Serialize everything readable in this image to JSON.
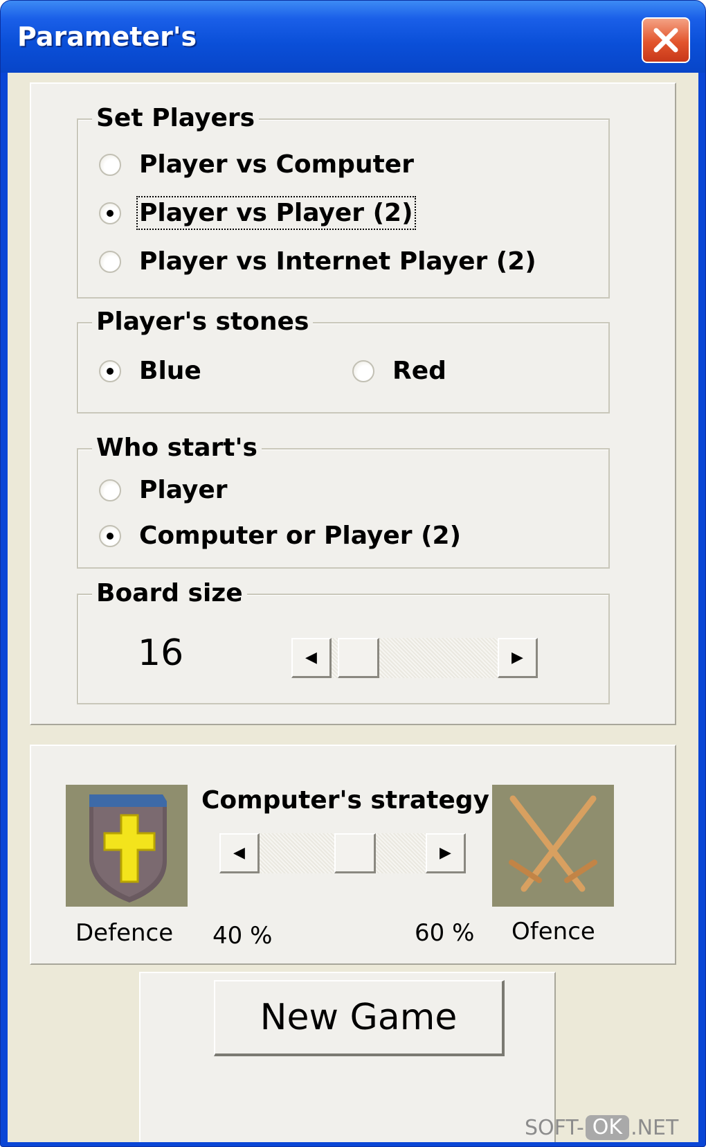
{
  "window": {
    "title": "Parameter's",
    "close_label": "X"
  },
  "set_players": {
    "legend": "Set Players",
    "options": [
      {
        "label": "Player vs Computer",
        "checked": false
      },
      {
        "label": "Player vs Player (2)",
        "checked": true
      },
      {
        "label": "Player vs Internet Player (2)",
        "checked": false
      }
    ]
  },
  "stones": {
    "legend": "Player's stones",
    "options": [
      {
        "label": "Blue",
        "checked": true
      },
      {
        "label": "Red",
        "checked": false
      }
    ]
  },
  "who_starts": {
    "legend": "Who start's",
    "options": [
      {
        "label": "Player",
        "checked": false
      },
      {
        "label": "Computer or Player (2)",
        "checked": true
      }
    ]
  },
  "board_size": {
    "legend": "Board size",
    "value": "16",
    "scroll_level": 0.05,
    "left_arrow": "◀",
    "right_arrow": "▶"
  },
  "strategy": {
    "label": "Computer's strategy",
    "defence_caption": "Defence",
    "offence_caption": "Ofence",
    "defence_percent": "40 %",
    "offence_percent": "60 %",
    "level": 0.6,
    "left_arrow": "◀",
    "right_arrow": "▶",
    "defence_icon": "shield-icon",
    "offence_icon": "crossed-swords-icon"
  },
  "new_game_label": "New Game",
  "watermark": {
    "prefix": "SOFT-",
    "badge": "OK",
    "suffix": ".NET"
  }
}
